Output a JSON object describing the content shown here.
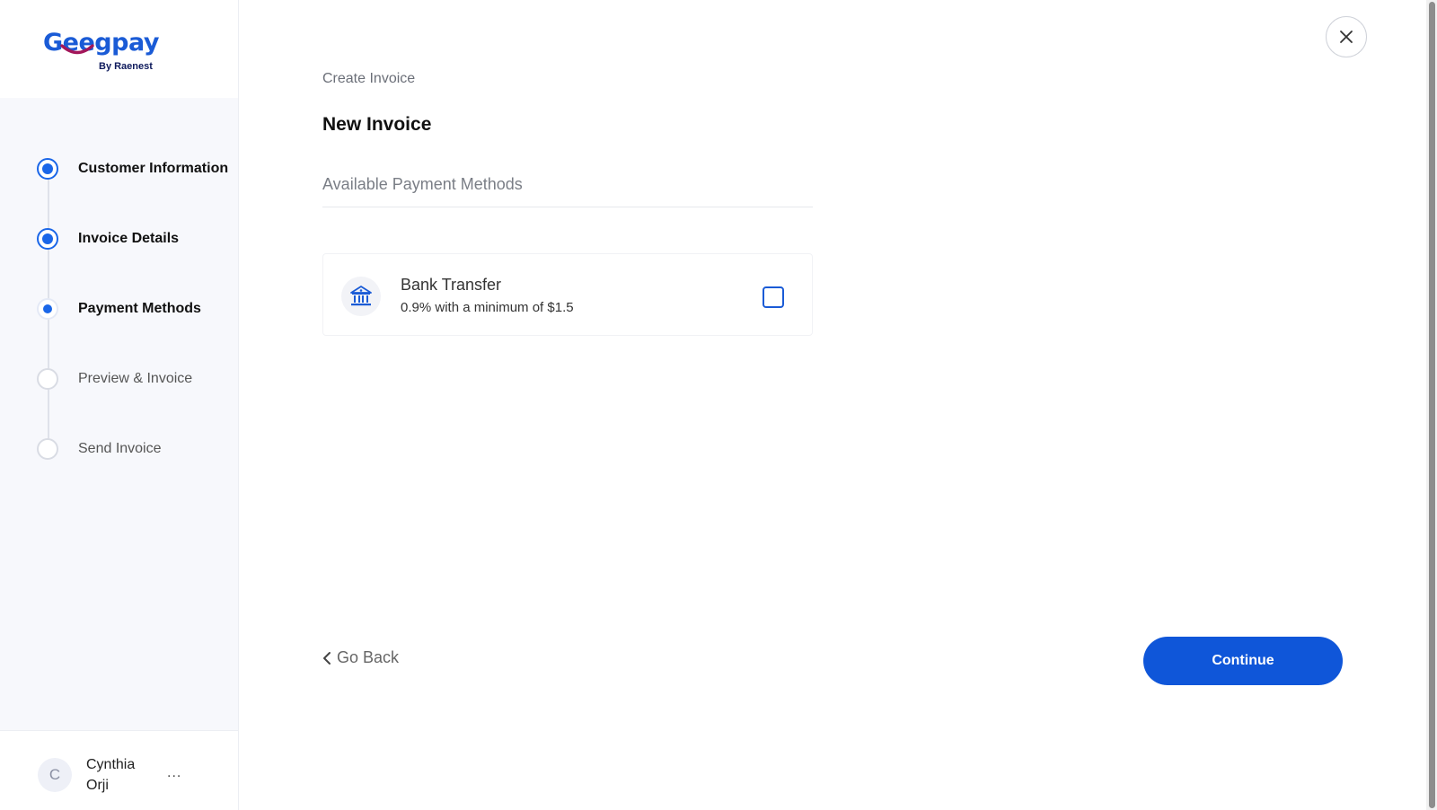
{
  "brand": {
    "name": "Geegpay",
    "tagline": "By Raenest",
    "colors": {
      "primary": "#1a5bd6",
      "smile": "#a3165a",
      "dark": "#0e1a5c"
    }
  },
  "steps": [
    {
      "label": "Customer Information",
      "state": "done"
    },
    {
      "label": "Invoice Details",
      "state": "done"
    },
    {
      "label": "Payment Methods",
      "state": "current"
    },
    {
      "label": "Preview & Invoice",
      "state": "pending"
    },
    {
      "label": "Send Invoice",
      "state": "pending"
    }
  ],
  "user": {
    "initial": "C",
    "name": "Cynthia Orji",
    "menu": "..."
  },
  "header": {
    "breadcrumb": "Create Invoice",
    "title": "New Invoice",
    "close_icon": "close-icon"
  },
  "payment": {
    "section_label": "Available Payment Methods",
    "methods": [
      {
        "name": "Bank Transfer",
        "fee": "0.9% with a minimum of $1.5",
        "icon": "bank-icon",
        "checked": false
      }
    ]
  },
  "footer": {
    "back_label": "Go Back",
    "continue_label": "Continue"
  }
}
